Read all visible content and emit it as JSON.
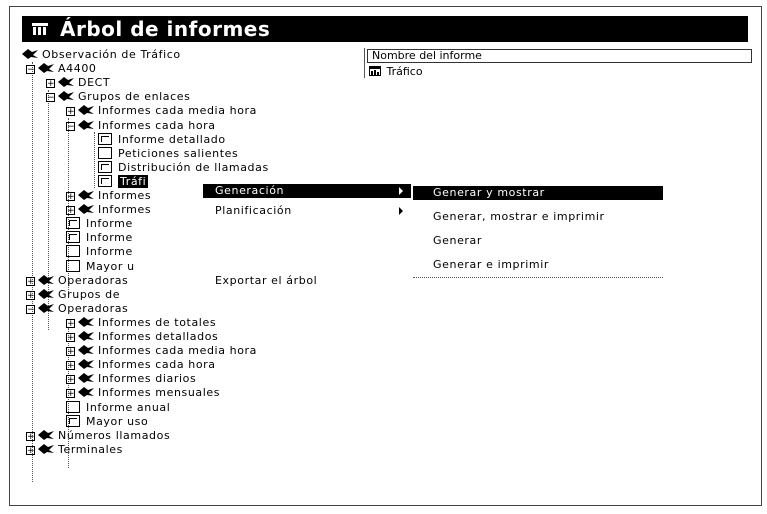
{
  "window": {
    "title": "Árbol de informes"
  },
  "tree": {
    "nodes": [
      {
        "label": "Observación de Tráfico",
        "type": "folder"
      },
      {
        "label": "A4400",
        "type": "folder",
        "expander": "-"
      },
      {
        "label": "DECT",
        "type": "folder",
        "expander": "+"
      },
      {
        "label": "Grupos de enlaces",
        "type": "folder",
        "expander": "-"
      },
      {
        "label": "Informes cada media hora",
        "type": "folder",
        "expander": "+"
      },
      {
        "label": "Informes cada hora",
        "type": "folder",
        "expander": "-"
      },
      {
        "label": "Informe detallado",
        "type": "report"
      },
      {
        "label": "Peticiones salientes",
        "type": "doc"
      },
      {
        "label": "Distribución de llamadas",
        "type": "report"
      },
      {
        "label": "Tráfi",
        "type": "report",
        "selected": true
      },
      {
        "label": "Informes",
        "type": "folder",
        "expander": "+"
      },
      {
        "label": "Informes",
        "type": "folder",
        "expander": "+"
      },
      {
        "label": "Informe",
        "type": "report"
      },
      {
        "label": "Informe",
        "type": "report"
      },
      {
        "label": "Informe",
        "type": "doc"
      },
      {
        "label": "Mayor u",
        "type": "doc"
      },
      {
        "label": "Operadoras",
        "type": "folder",
        "expander": "+"
      },
      {
        "label": "Grupos de",
        "type": "folder",
        "expander": "+"
      },
      {
        "label": "Operadoras",
        "type": "folder",
        "expander": "-"
      },
      {
        "label": "Informes de totales",
        "type": "folder",
        "expander": "+"
      },
      {
        "label": "Informes detallados",
        "type": "folder",
        "expander": "+"
      },
      {
        "label": "Informes cada media hora",
        "type": "folder",
        "expander": "+"
      },
      {
        "label": "Informes cada hora",
        "type": "folder",
        "expander": "+"
      },
      {
        "label": "Informes diarios",
        "type": "folder",
        "expander": "+"
      },
      {
        "label": "Informes mensuales",
        "type": "folder",
        "expander": "+"
      },
      {
        "label": "Informe anual",
        "type": "doc"
      },
      {
        "label": "Mayor uso",
        "type": "report"
      },
      {
        "label": "Números llamados",
        "type": "folder",
        "expander": "+"
      },
      {
        "label": "Terminales",
        "type": "folder",
        "expander": "+"
      }
    ]
  },
  "list": {
    "header": "Nombre del informe",
    "rows": [
      {
        "label": "Tráfico"
      }
    ]
  },
  "context_menu": {
    "items": [
      {
        "label": "Generación",
        "highlighted": true,
        "submenu": true
      },
      {
        "label": "Planificación",
        "submenu": true
      },
      {
        "label": "Exportar el árbol"
      }
    ]
  },
  "submenu": {
    "items": [
      {
        "label": "Generar y mostrar",
        "highlighted": true
      },
      {
        "label": "Generar, mostrar e imprimir"
      },
      {
        "label": "Generar"
      },
      {
        "label": "Generar e imprimir"
      }
    ]
  }
}
